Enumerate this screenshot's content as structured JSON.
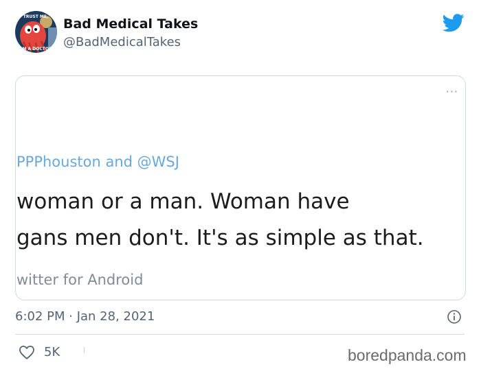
{
  "author": {
    "display_name": "Bad Medical Takes",
    "handle": "@BadMedicalTakes",
    "avatar_icon": "zoidberg-avatar",
    "avatar_text_top": "TRUST ME,",
    "avatar_text_bottom": "I'M A DOCTOR"
  },
  "platform_icon": "twitter-bird-icon",
  "embedded_tweet": {
    "more_icon": "more-dots-icon",
    "more_label": "···",
    "mentions": "PPPhouston and @WSJ",
    "text_line_1": "woman or a man. Woman have",
    "text_line_2": "gans men don't. It's as simple as that.",
    "source": "witter for Android"
  },
  "timestamp": "6:02 PM · Jan 28, 2021",
  "info_icon": "info-icon",
  "actions": {
    "like_icon": "heart-icon",
    "like_count": "5K"
  },
  "watermark": "boredpanda.com",
  "colors": {
    "twitter_blue": "#1d9bf0",
    "mention_blue": "#6aa8d9",
    "secondary_text": "#536471",
    "border": "#cfd9de"
  }
}
